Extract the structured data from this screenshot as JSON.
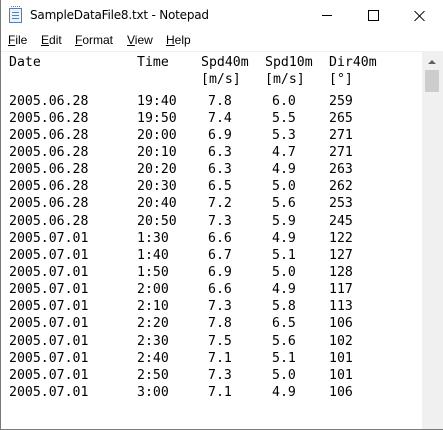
{
  "window": {
    "title": "SampleDataFile8.txt - Notepad"
  },
  "menu": {
    "items": [
      {
        "label": "File",
        "key": "F",
        "rest": "ile"
      },
      {
        "label": "Edit",
        "key": "E",
        "rest": "dit"
      },
      {
        "label": "Format",
        "key": "F",
        "rest": "ormat"
      },
      {
        "label": "View",
        "key": "V",
        "rest": "iew"
      },
      {
        "label": "Help",
        "key": "H",
        "rest": "elp"
      }
    ]
  },
  "content": {
    "header": [
      "Date",
      "Time",
      "Spd40m",
      "Spd10m",
      "Dir40m"
    ],
    "units": [
      "",
      "",
      "[m/s]",
      "[m/s]",
      "[°]"
    ],
    "rows": [
      [
        "2005.06.28",
        "19:40",
        "7.8",
        "6.0",
        "259"
      ],
      [
        "2005.06.28",
        "19:50",
        "7.4",
        "5.5",
        "265"
      ],
      [
        "2005.06.28",
        "20:00",
        "6.9",
        "5.3",
        "271"
      ],
      [
        "2005.06.28",
        "20:10",
        "6.3",
        "4.7",
        "271"
      ],
      [
        "2005.06.28",
        "20:20",
        "6.3",
        "4.9",
        "263"
      ],
      [
        "2005.06.28",
        "20:30",
        "6.5",
        "5.0",
        "262"
      ],
      [
        "2005.06.28",
        "20:40",
        "7.2",
        "5.6",
        "253"
      ],
      [
        "2005.06.28",
        "20:50",
        "7.3",
        "5.9",
        "245"
      ],
      [
        "2005.07.01",
        "1:30",
        "6.6",
        "4.9",
        "122"
      ],
      [
        "2005.07.01",
        "1:40",
        "6.7",
        "5.1",
        "127"
      ],
      [
        "2005.07.01",
        "1:50",
        "6.9",
        "5.0",
        "128"
      ],
      [
        "2005.07.01",
        "2:00",
        "6.6",
        "4.9",
        "117"
      ],
      [
        "2005.07.01",
        "2:10",
        "7.3",
        "5.8",
        "113"
      ],
      [
        "2005.07.01",
        "2:20",
        "7.8",
        "6.5",
        "106"
      ],
      [
        "2005.07.01",
        "2:30",
        "7.5",
        "5.6",
        "102"
      ],
      [
        "2005.07.01",
        "2:40",
        "7.1",
        "5.1",
        "101"
      ],
      [
        "2005.07.01",
        "2:50",
        "7.3",
        "5.0",
        "101"
      ],
      [
        "2005.07.01",
        "3:00",
        "7.1",
        "4.9",
        "106"
      ]
    ]
  },
  "scrollbar": {
    "position_fraction": 0.0
  }
}
